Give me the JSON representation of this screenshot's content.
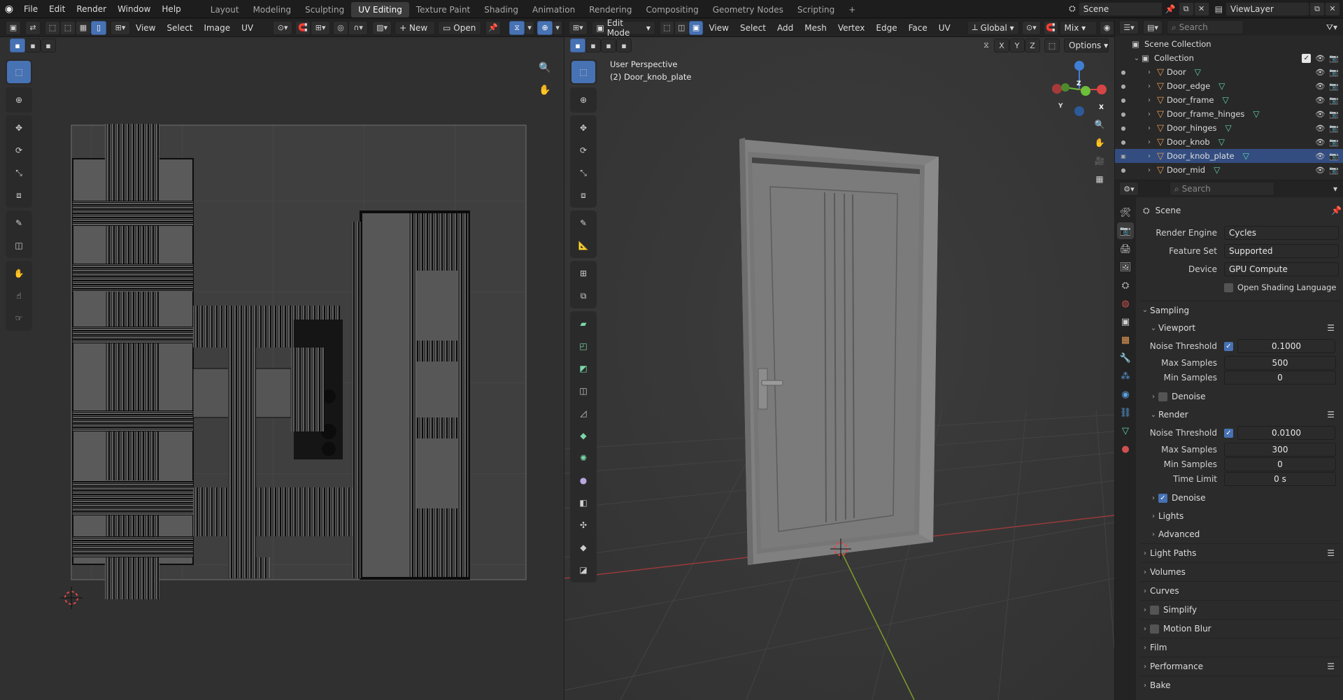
{
  "topbar": {
    "menus": [
      "File",
      "Edit",
      "Render",
      "Window",
      "Help"
    ],
    "workspaces": [
      "Layout",
      "Modeling",
      "Sculpting",
      "UV Editing",
      "Texture Paint",
      "Shading",
      "Animation",
      "Rendering",
      "Compositing",
      "Geometry Nodes",
      "Scripting"
    ],
    "active_workspace": "UV Editing",
    "add_tab": "+",
    "scene": "Scene",
    "view_layer": "ViewLayer"
  },
  "uv_editor": {
    "menus": [
      "View",
      "Select",
      "Image",
      "UV"
    ],
    "new_label": "New",
    "open_label": "Open"
  },
  "viewport": {
    "mode": "Edit Mode",
    "menus": [
      "View",
      "Select",
      "Add",
      "Mesh",
      "Vertex",
      "Edge",
      "Face",
      "UV"
    ],
    "transform_orientation": "Global",
    "shading": "Mix",
    "options_label": "Options",
    "perspective_label": "User Perspective",
    "object_label": "(2) Door_knob_plate",
    "axis_x": "X",
    "axis_y": "Y",
    "axis_z": "Z"
  },
  "outliner": {
    "search_placeholder": "Search",
    "scene_collection": "Scene Collection",
    "collection": "Collection",
    "items": [
      "Door",
      "Door_edge",
      "Door_frame",
      "Door_frame_hinges",
      "Door_hinges",
      "Door_knob",
      "Door_knob_plate",
      "Door_mid"
    ],
    "selected": "Door_knob_plate"
  },
  "properties": {
    "search_placeholder": "Search",
    "context": "Scene",
    "render_engine_label": "Render Engine",
    "render_engine": "Cycles",
    "feature_set_label": "Feature Set",
    "feature_set": "Supported",
    "device_label": "Device",
    "device": "GPU Compute",
    "osl_label": "Open Shading Language",
    "sampling": "Sampling",
    "viewport": "Viewport",
    "noise_threshold_label": "Noise Threshold",
    "vp_noise_threshold": "0.1000",
    "max_samples_label": "Max Samples",
    "vp_max_samples": "500",
    "min_samples_label": "Min Samples",
    "vp_min_samples": "0",
    "denoise_label": "Denoise",
    "render": "Render",
    "r_noise_threshold": "0.0100",
    "r_max_samples": "300",
    "r_min_samples": "0",
    "time_limit_label": "Time Limit",
    "r_time_limit": "0 s",
    "lights": "Lights",
    "advanced": "Advanced",
    "light_paths": "Light Paths",
    "volumes": "Volumes",
    "curves": "Curves",
    "simplify": "Simplify",
    "motion_blur": "Motion Blur",
    "film": "Film",
    "performance": "Performance",
    "bake": "Bake"
  },
  "colors": {
    "accent": "#4772b3",
    "selected_row": "#334d80",
    "object_icon": "#e39a55",
    "mesh_icon": "#62d3a5"
  }
}
